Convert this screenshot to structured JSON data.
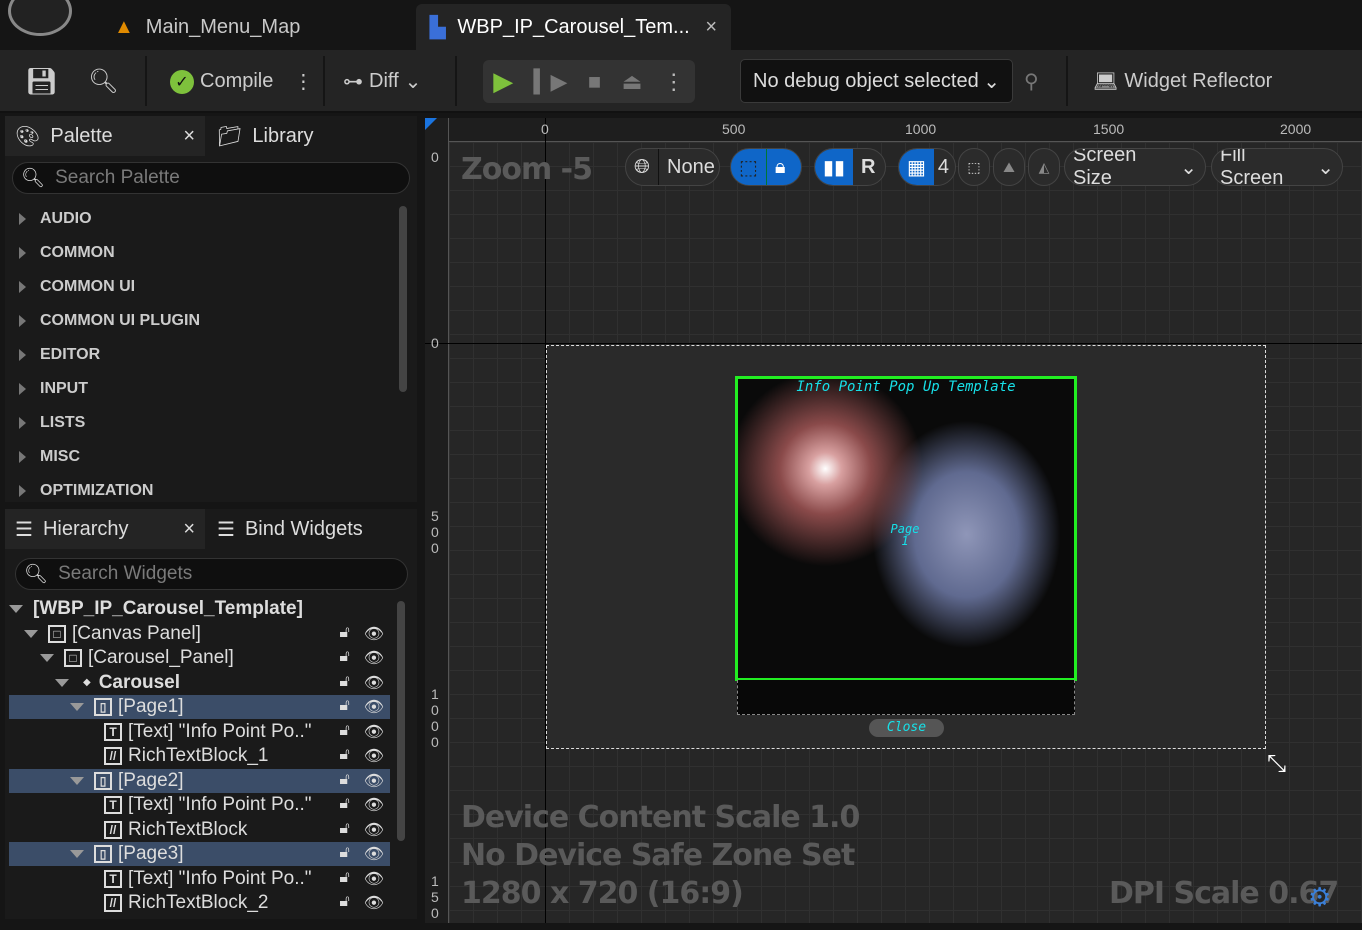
{
  "tabs": [
    {
      "label": "Main_Menu_Map"
    },
    {
      "label": "WBP_IP_Carousel_Tem...",
      "close": "×"
    }
  ],
  "toolbar": {
    "compile": "Compile",
    "diff": "Diff",
    "debug_object": "No debug object selected",
    "widget_reflector": "Widget Reflector"
  },
  "palette": {
    "title": "Palette",
    "close": "×",
    "library": "Library",
    "search_placeholder": "Search Palette",
    "categories": [
      "AUDIO",
      "COMMON",
      "COMMON UI",
      "COMMON UI PLUGIN",
      "EDITOR",
      "INPUT",
      "LISTS",
      "MISC",
      "OPTIMIZATION"
    ]
  },
  "hierarchy": {
    "title": "Hierarchy",
    "close": "×",
    "bind_widgets": "Bind Widgets",
    "search_placeholder": "Search Widgets",
    "items": [
      {
        "label": "[WBP_IP_Carousel_Template]"
      },
      {
        "label": "[Canvas Panel]"
      },
      {
        "label": "[Carousel_Panel]"
      },
      {
        "label": "Carousel"
      },
      {
        "label": "[Page1]"
      },
      {
        "label": "[Text] \"Info Point Po..\""
      },
      {
        "label": "RichTextBlock_1"
      },
      {
        "label": "[Page2]"
      },
      {
        "label": "[Text] \"Info Point Po..\""
      },
      {
        "label": "RichTextBlock"
      },
      {
        "label": "[Page3]"
      },
      {
        "label": "[Text] \"Info Point Po..\""
      },
      {
        "label": "RichTextBlock_2"
      }
    ]
  },
  "viewport": {
    "zoom": "Zoom -5",
    "none": "None",
    "r": "R",
    "grid_snap": "4",
    "screen_size": "Screen Size",
    "fill_screen": "Fill Screen",
    "ruler_h": [
      "0",
      "500",
      "1000",
      "1500",
      "2000"
    ],
    "ruler_v": [
      "0",
      "0",
      "500",
      "1000",
      "150"
    ],
    "device_scale": "Device Content Scale 1.0",
    "safe_zone": "No Device Safe Zone Set",
    "resolution": "1280 x 720 (16:9)",
    "dpi": "DPI Scale 0.67",
    "widget_title": "Info Point Pop Up Template",
    "page_label": "Page 1",
    "close_button": "Close"
  }
}
